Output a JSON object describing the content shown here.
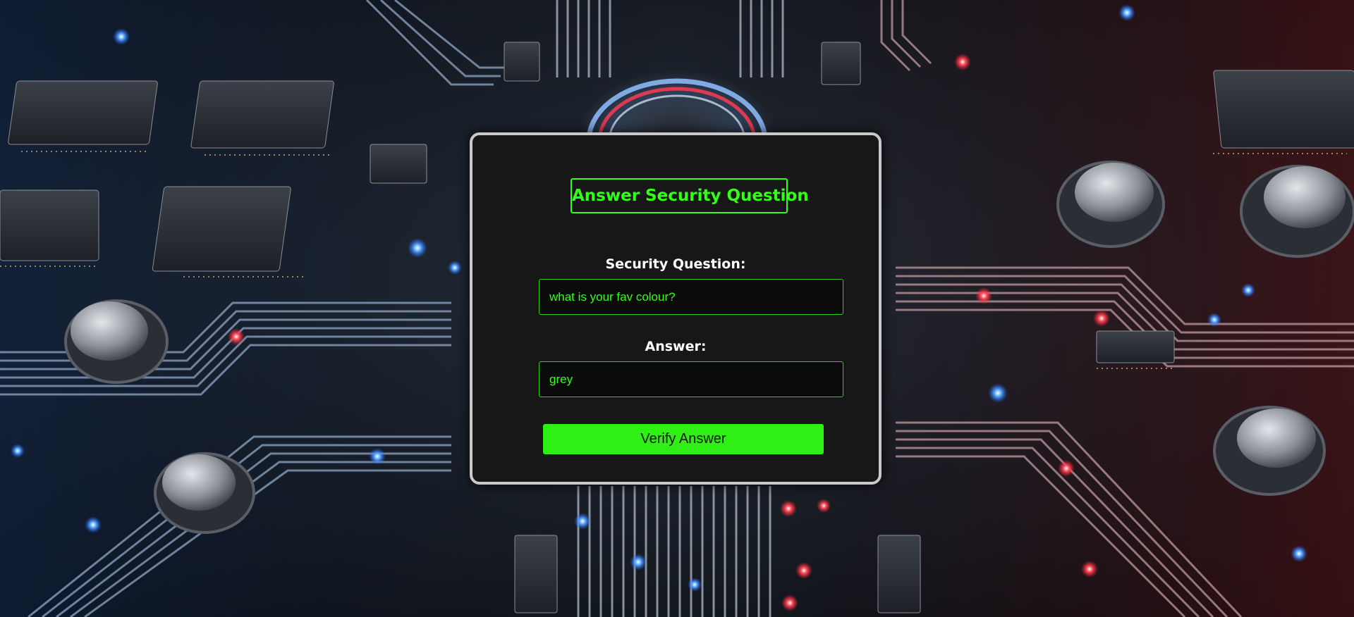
{
  "form": {
    "title": "Answer Security Question",
    "question_label": "Security Question:",
    "question_value": "what is your fav colour?",
    "answer_label": "Answer:",
    "answer_value": "grey",
    "submit_label": "Verify Answer"
  },
  "colors": {
    "accent": "#33ff1a",
    "button": "#2ef014",
    "card": "#171717",
    "card_border": "#c9c9c9"
  },
  "background": {
    "icon": "circuit-board-icon"
  }
}
